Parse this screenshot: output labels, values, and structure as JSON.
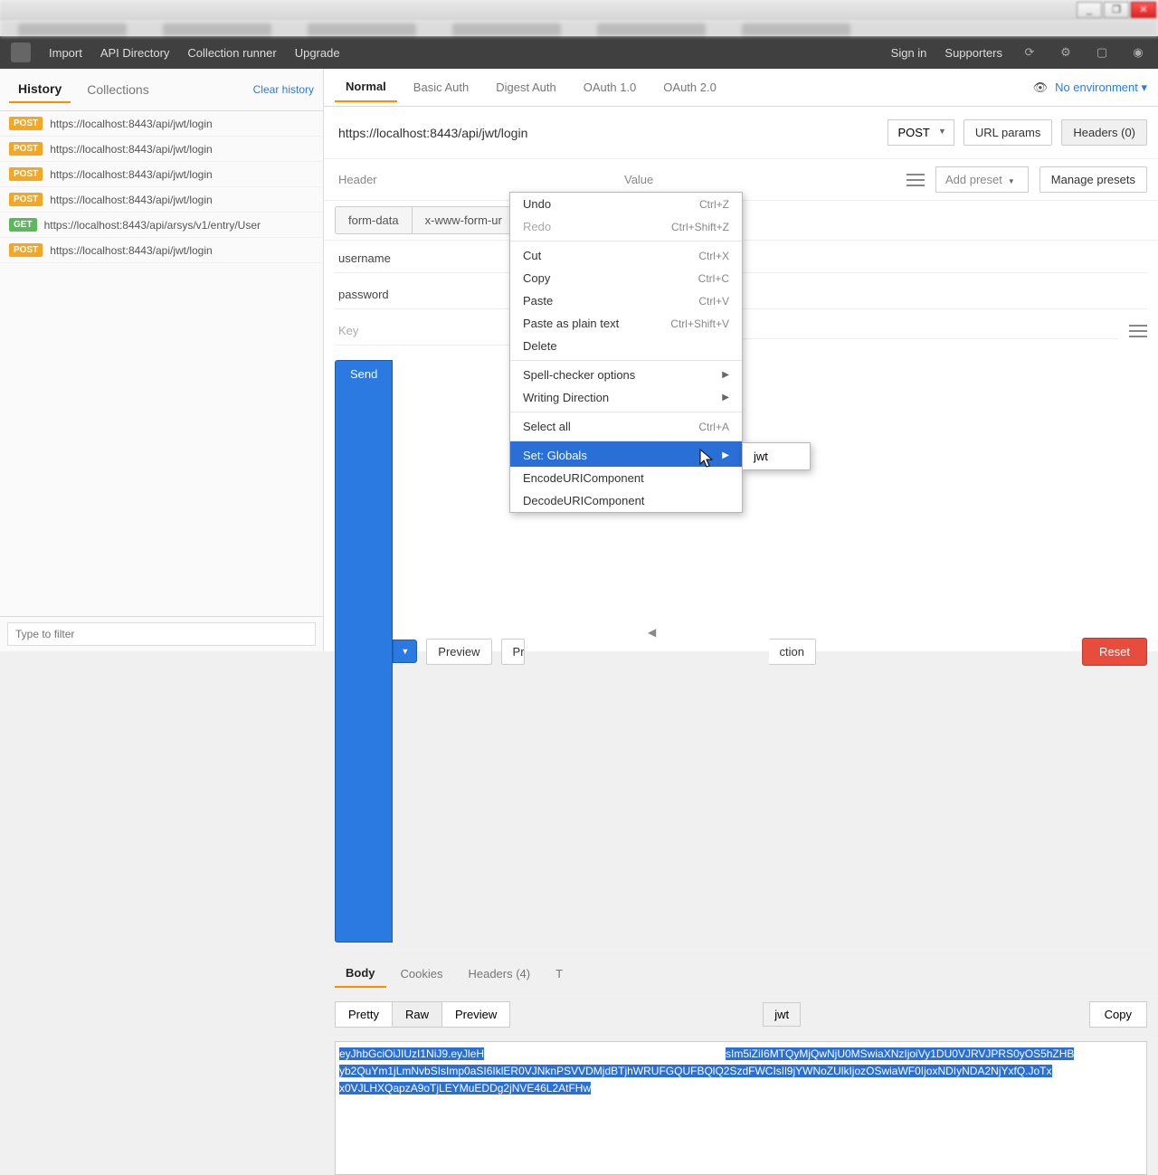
{
  "window": {
    "min": "_",
    "max": "❐",
    "close": "✕"
  },
  "topbar": {
    "import": "Import",
    "apidir": "API Directory",
    "runner": "Collection runner",
    "upgrade": "Upgrade",
    "signin": "Sign in",
    "supporters": "Supporters"
  },
  "sidebar": {
    "tabs": {
      "history": "History",
      "collections": "Collections"
    },
    "clear": "Clear history",
    "items": [
      {
        "method": "POST",
        "url": "https://localhost:8443/api/jwt/login"
      },
      {
        "method": "POST",
        "url": "https://localhost:8443/api/jwt/login"
      },
      {
        "method": "POST",
        "url": "https://localhost:8443/api/jwt/login"
      },
      {
        "method": "POST",
        "url": "https://localhost:8443/api/jwt/login"
      },
      {
        "method": "GET",
        "url": "https://localhost:8443/api/arsys/v1/entry/User"
      },
      {
        "method": "POST",
        "url": "https://localhost:8443/api/jwt/login"
      }
    ],
    "filter_placeholder": "Type to filter"
  },
  "request": {
    "tabs": [
      "Normal",
      "Basic Auth",
      "Digest Auth",
      "OAuth 1.0",
      "OAuth 2.0"
    ],
    "env_label": "No environment",
    "url": "https://localhost:8443/api/jwt/login",
    "method": "POST",
    "url_params_btn": "URL params",
    "headers_btn": "Headers (0)",
    "header_col": "Header",
    "value_col": "Value",
    "add_preset": "Add preset",
    "manage_presets": "Manage presets",
    "bodytypes": [
      "form-data",
      "x-www-form-ur"
    ],
    "fields": [
      {
        "k": "username",
        "v": ""
      },
      {
        "k": "password",
        "v": ""
      }
    ],
    "key_ph": "Key",
    "send": "Send",
    "preview": "Preview",
    "pr": "Pr",
    "ction": "ction",
    "reset": "Reset"
  },
  "response": {
    "tabs": [
      "Body",
      "Cookies",
      "Headers (4)",
      "T"
    ],
    "views": [
      "Pretty",
      "Raw",
      "Preview"
    ],
    "jwt": "jwt",
    "copy": "Copy",
    "body_left": "eyJhbGciOiJIUzI1NiJ9.eyJleH",
    "body_right": "sIm5iZiI6MTQyMjQwNjU0MSwiaXNzIjoiVy1DU0VJRVJPRS0yOS5hZHB",
    "body_line2": "yb2QuYm1jLmNvbSIsImp0aSI6IklER0VJNknPSVVDMjdBTjhWRUFGQUFBQlQ2SzdFWCIsIl9jYWNoZUlkIjozOSwiaWF0IjoxNDIyNDA2NjYxfQ.JoTx",
    "body_line3": "x0VJLHXQapzA9oTjLEYMuEDDg2jNVE46L2AtFHw"
  },
  "ctx": {
    "undo": {
      "t": "Undo",
      "sc": "Ctrl+Z"
    },
    "redo": {
      "t": "Redo",
      "sc": "Ctrl+Shift+Z"
    },
    "cut": {
      "t": "Cut",
      "sc": "Ctrl+X"
    },
    "copy": {
      "t": "Copy",
      "sc": "Ctrl+C"
    },
    "paste": {
      "t": "Paste",
      "sc": "Ctrl+V"
    },
    "pasteplain": {
      "t": "Paste as plain text",
      "sc": "Ctrl+Shift+V"
    },
    "delete": {
      "t": "Delete"
    },
    "spell": {
      "t": "Spell-checker options"
    },
    "writedir": {
      "t": "Writing Direction"
    },
    "selectall": {
      "t": "Select all",
      "sc": "Ctrl+A"
    },
    "setglobals": {
      "t": "Set: Globals"
    },
    "encode": {
      "t": "EncodeURIComponent"
    },
    "decode": {
      "t": "DecodeURIComponent"
    }
  },
  "submenu": {
    "jwt": "jwt"
  }
}
